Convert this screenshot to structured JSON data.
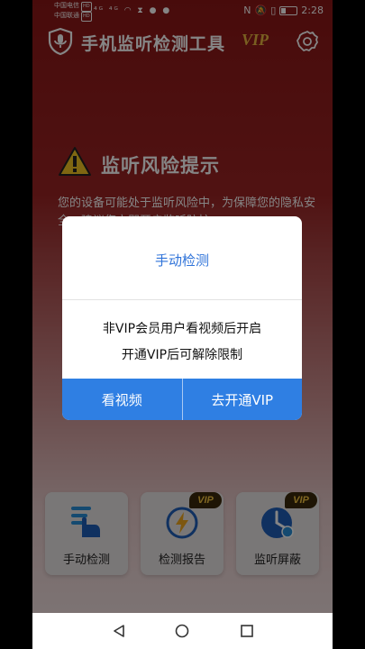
{
  "status_bar": {
    "carrier1": "中国电信",
    "carrier2": "中国联通",
    "carrier_badge": "HD",
    "time": "2:28"
  },
  "header": {
    "title": "手机监听检测工具",
    "vip_label": "VIP",
    "logo_icon": "shield-mic-icon",
    "settings_icon": "gear-icon"
  },
  "risk": {
    "icon": "warning-icon",
    "title": "监听风险提示",
    "description": "您的设备可能处于监听风险中，为保障您的隐私安全，建议您立即开启监听防护"
  },
  "dialog": {
    "title": "手动检测",
    "message_line1": "非VIP会员用户看视频后开启",
    "message_line2": "开通VIP后可解除限制",
    "watch_button": "看视频",
    "open_vip_button": "去开通VIP"
  },
  "features": [
    {
      "label": "手动检测",
      "icon": "hand-scan-icon",
      "vip": ""
    },
    {
      "label": "检测报告",
      "icon": "report-bolt-icon",
      "vip": "VIP"
    },
    {
      "label": "监听屏蔽",
      "icon": "shield-block-icon",
      "vip": "VIP"
    }
  ],
  "colors": {
    "accent_blue": "#2f7fe3",
    "title_blue": "#2f73d9",
    "header_red": "#8b1616",
    "vip_gold": "#e8b740"
  }
}
